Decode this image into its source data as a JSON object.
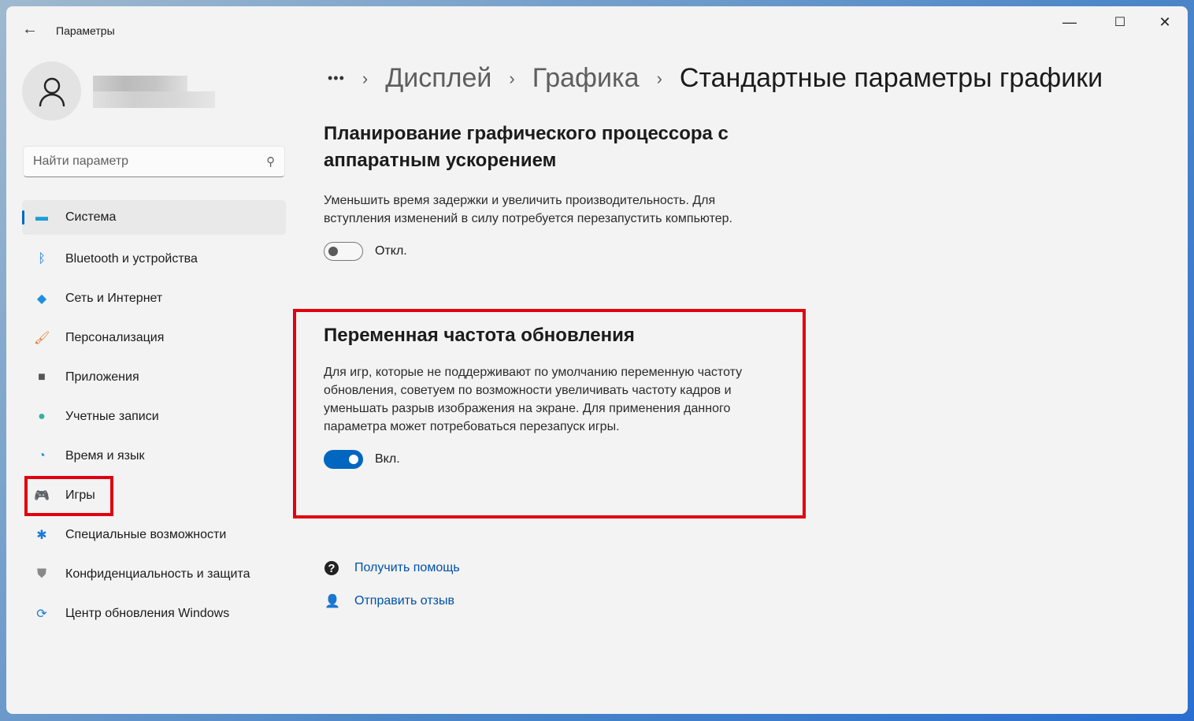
{
  "window": {
    "title": "Параметры",
    "minimize": "—",
    "maximize": "☐",
    "close": "✕"
  },
  "search": {
    "placeholder": "Найти параметр"
  },
  "nav": [
    {
      "label": "Система",
      "icon": "display-icon",
      "selected": true
    },
    {
      "label": "Bluetooth и устройства",
      "icon": "bluetooth-icon"
    },
    {
      "label": "Сеть и Интернет",
      "icon": "wifi-icon"
    },
    {
      "label": "Персонализация",
      "icon": "brush-icon"
    },
    {
      "label": "Приложения",
      "icon": "apps-icon"
    },
    {
      "label": "Учетные записи",
      "icon": "account-icon"
    },
    {
      "label": "Время и язык",
      "icon": "time-language-icon"
    },
    {
      "label": "Игры",
      "icon": "gamepad-icon",
      "highlighted": true
    },
    {
      "label": "Специальные возможности",
      "icon": "accessibility-icon"
    },
    {
      "label": "Конфиденциальность и защита",
      "icon": "shield-icon"
    },
    {
      "label": "Центр обновления Windows",
      "icon": "update-icon"
    }
  ],
  "breadcrumb": {
    "more": "•••",
    "items": [
      "Дисплей",
      "Графика"
    ],
    "current": "Стандартные параметры графики",
    "sep": "›"
  },
  "hags": {
    "title": "Планирование графического процессора с аппаратным ускорением",
    "desc": "Уменьшить время задержки и увеличить производительность. Для вступления изменений в силу потребуется перезапустить компьютер.",
    "state": "Откл.",
    "on": false
  },
  "vrr": {
    "title": "Переменная частота обновления",
    "desc": "Для игр, которые не поддерживают по умолчанию переменную частоту обновления, советуем по возможности увеличивать частоту кадров и уменьшать разрыв изображения на экране. Для применения данного параметра может потребоваться перезапуск игры.",
    "state": "Вкл.",
    "on": true
  },
  "links": {
    "help": "Получить помощь",
    "feedback": "Отправить отзыв"
  },
  "colors": {
    "accent": "#0067c0",
    "highlight": "#e00010",
    "link": "#0050a8"
  }
}
